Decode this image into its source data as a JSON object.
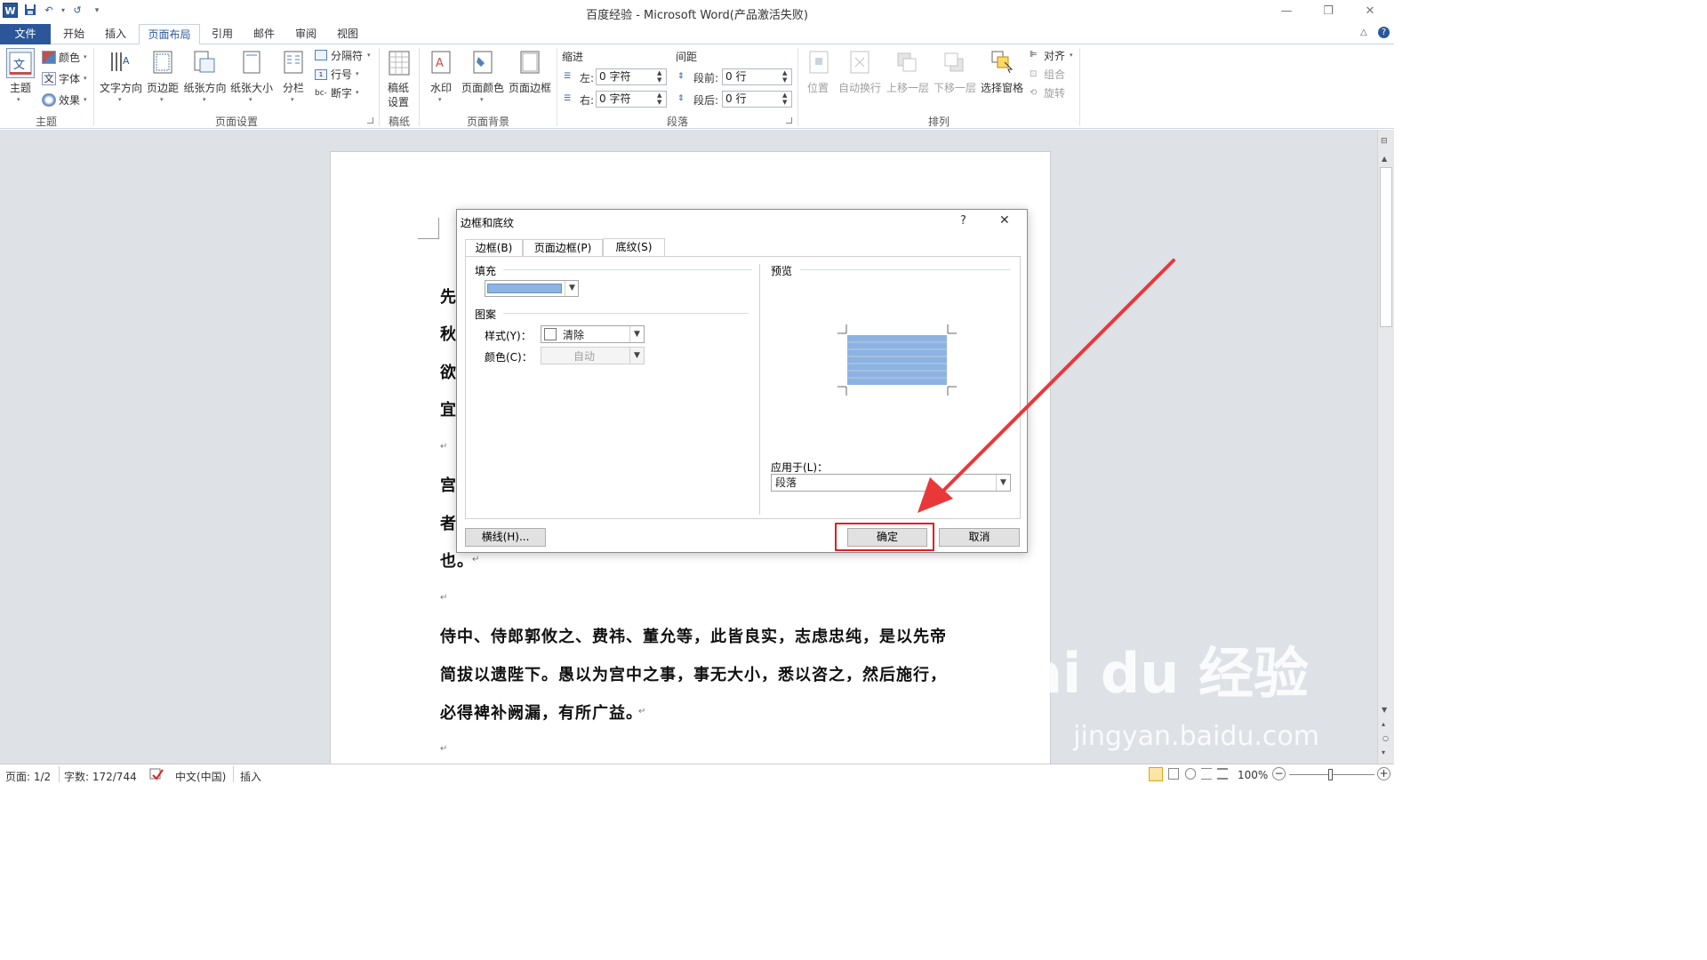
{
  "window": {
    "title": "百度经验 - Microsoft Word(产品激活失败)",
    "controls": {
      "minimize": "—",
      "restore": "❐",
      "close": "✕"
    }
  },
  "quick_access": {
    "app_icon": "W",
    "save": "💾",
    "undo": "↶",
    "redo": "↺",
    "more": "▾"
  },
  "tabs": {
    "file": "文件",
    "items": [
      "开始",
      "插入",
      "页面布局",
      "引用",
      "邮件",
      "审阅",
      "视图"
    ],
    "active": "页面布局",
    "help_up": "△",
    "help": "?"
  },
  "ribbon": {
    "theme_group": {
      "label": "主题",
      "theme_btn": "主题",
      "colors": "颜色",
      "fonts": "字体",
      "effects": "效果"
    },
    "page_setup": {
      "label": "页面设置",
      "text_direction": "文字方向",
      "margins": "页边距",
      "orientation": "纸张方向",
      "size": "纸张大小",
      "columns": "分栏",
      "breaks": "分隔符",
      "line_numbers": "行号",
      "hyphenation": "断字"
    },
    "manuscript": {
      "label": "稿纸",
      "btn_line1": "稿纸",
      "btn_line2": "设置"
    },
    "page_background": {
      "label": "页面背景",
      "watermark": "水印",
      "page_color": "页面颜色",
      "page_borders": "页面边框"
    },
    "paragraph": {
      "label": "段落",
      "indent_label": "缩进",
      "spacing_label": "间距",
      "left": "左:",
      "left_val": "0 字符",
      "right": "右:",
      "right_val": "0 字符",
      "before": "段前:",
      "before_val": "0 行",
      "after": "段后:",
      "after_val": "0 行"
    },
    "arrange": {
      "label": "排列",
      "position": "位置",
      "wrap": "自动换行",
      "forward": "上移一层",
      "backward": "下移一层",
      "selection_pane": "选择窗格",
      "align": "对齐",
      "group": "组合",
      "rotate": "旋转"
    }
  },
  "document": {
    "partial_lines": [
      "先",
      "秋",
      "欲",
      "宜",
      "宫",
      "者",
      "也。"
    ],
    "para_mark": "↵",
    "lines": [
      "侍中、侍郎郭攸之、费祎、董允等，此皆良实，志虑忠纯，是以先帝",
      "简拔以遗陛下。愚以为宫中之事，事无大小，悉以咨之，然后施行，",
      "必得裨补阙漏，有所广益。"
    ]
  },
  "dialog": {
    "title": "边框和底纹",
    "help": "?",
    "close": "✕",
    "tabs": [
      "边框(B)",
      "页面边框(P)",
      "底纹(S)"
    ],
    "active_tab": "底纹(S)",
    "fill_label": "填充",
    "fill_color": "#8db3e2",
    "pattern_label": "图案",
    "style_label": "样式(Y)：",
    "style_value": "清除",
    "color_label": "颜色(C)：",
    "color_value": "自动",
    "preview_label": "预览",
    "apply_label": "应用于(L)：",
    "apply_value": "段落",
    "hline_button": "横线(H)...",
    "ok_button": "确定",
    "cancel_button": "取消"
  },
  "status_bar": {
    "page": "页面: 1/2",
    "words": "字数: 172/744",
    "language": "中文(中国)",
    "mode": "插入",
    "zoom": "100%",
    "zoom_minus": "−",
    "zoom_plus": "+"
  },
  "watermark": {
    "main": "Bai du 经验",
    "sub": "jingyan.baidu.com"
  },
  "colors": {
    "accent": "#2b579a",
    "highlight": "#e02020",
    "arrow": "#e8383a"
  }
}
